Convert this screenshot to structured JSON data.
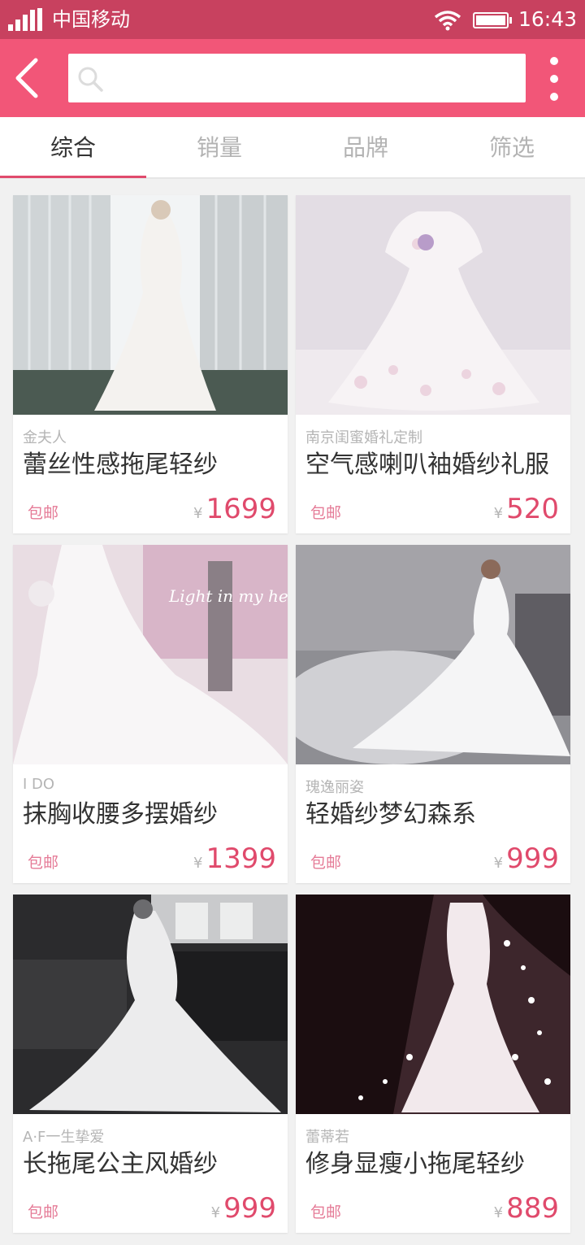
{
  "status_bar": {
    "carrier": "中国移动",
    "time": "16:43"
  },
  "search": {
    "placeholder": ""
  },
  "tabs": [
    {
      "label": "综合",
      "active": true
    },
    {
      "label": "销量",
      "active": false
    },
    {
      "label": "品牌",
      "active": false
    },
    {
      "label": "筛选",
      "active": false
    }
  ],
  "products": [
    {
      "shop": "金夫人",
      "title": "蕾丝性感拖尾轻纱",
      "shipping": "包邮",
      "currency": "¥",
      "price": "1699",
      "image_tone": "curtain"
    },
    {
      "shop": "南京闺蜜婚礼定制",
      "title": "空气感喇叭袖婚纱礼服",
      "shipping": "包邮",
      "currency": "¥",
      "price": "520",
      "image_tone": "lilac"
    },
    {
      "shop": "I DO",
      "title": "抹胸收腰多摆婚纱",
      "shipping": "包邮",
      "currency": "¥",
      "price": "1399",
      "image_tone": "pink"
    },
    {
      "shop": "瑰逸丽姿",
      "title": "轻婚纱梦幻森系",
      "shipping": "包邮",
      "currency": "¥",
      "price": "999",
      "image_tone": "mist"
    },
    {
      "shop": "A·F一生挚爱",
      "title": "长拖尾公主风婚纱",
      "shipping": "包邮",
      "currency": "¥",
      "price": "999",
      "image_tone": "dark"
    },
    {
      "shop": "蕾蒂若",
      "title": "修身显瘦小拖尾轻纱",
      "shipping": "包邮",
      "currency": "¥",
      "price": "889",
      "image_tone": "black"
    }
  ],
  "image_overlay_text": "Light in my heart",
  "colors": {
    "status_bar": "#c8415f",
    "nav_bar": "#f25678",
    "accent": "#e04a6c"
  }
}
